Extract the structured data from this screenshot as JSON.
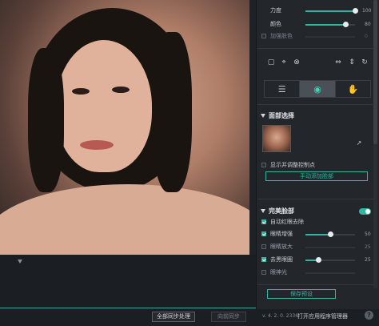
{
  "sliders_top": [
    {
      "label": "力度",
      "value": "100",
      "fraction": 1.0
    },
    {
      "label": "颜色",
      "value": "80",
      "fraction": 0.8
    }
  ],
  "detail_color": {
    "label": "加强肤色",
    "value": "0",
    "checked": false
  },
  "toolbar_icons": [
    "crop-frame-icon",
    "crop-icon",
    "reset-circle-icon",
    "flip-horizontal-icon",
    "flip-vertical-icon",
    "rotate-icon"
  ],
  "tabs": [
    "adjust-sliders-icon",
    "face-sparkle-icon",
    "hand-wave-icon"
  ],
  "face_select": {
    "title": "面部选择",
    "show_points_label": "显示并调整控制点",
    "manual_button": "手动添加脸部"
  },
  "perfect_face": {
    "title": "完美脸部",
    "auto_redeye": "自动红眼去除",
    "items": [
      {
        "label": "眼睛增强",
        "value": "50",
        "checked": true,
        "fraction": 0.5
      },
      {
        "label": "眼睛放大",
        "value": "25",
        "checked": false,
        "fraction": 0.25
      },
      {
        "label": "去黑眼圈",
        "value": "25",
        "checked": true,
        "fraction": 0.25
      },
      {
        "label": "眼神光",
        "value": "",
        "checked": false,
        "fraction": 0.5
      }
    ]
  },
  "save_preset": "保存预设",
  "bottom": {
    "sync_all": "全部同步处理",
    "sync_back": "向前同步"
  },
  "footer": {
    "version": "v. 4. 2. 0. 2336",
    "open_manager": "打开应用程序管理器",
    "help": "?"
  },
  "colors": {
    "accent": "#2fb5a0",
    "panel": "#23272c"
  }
}
